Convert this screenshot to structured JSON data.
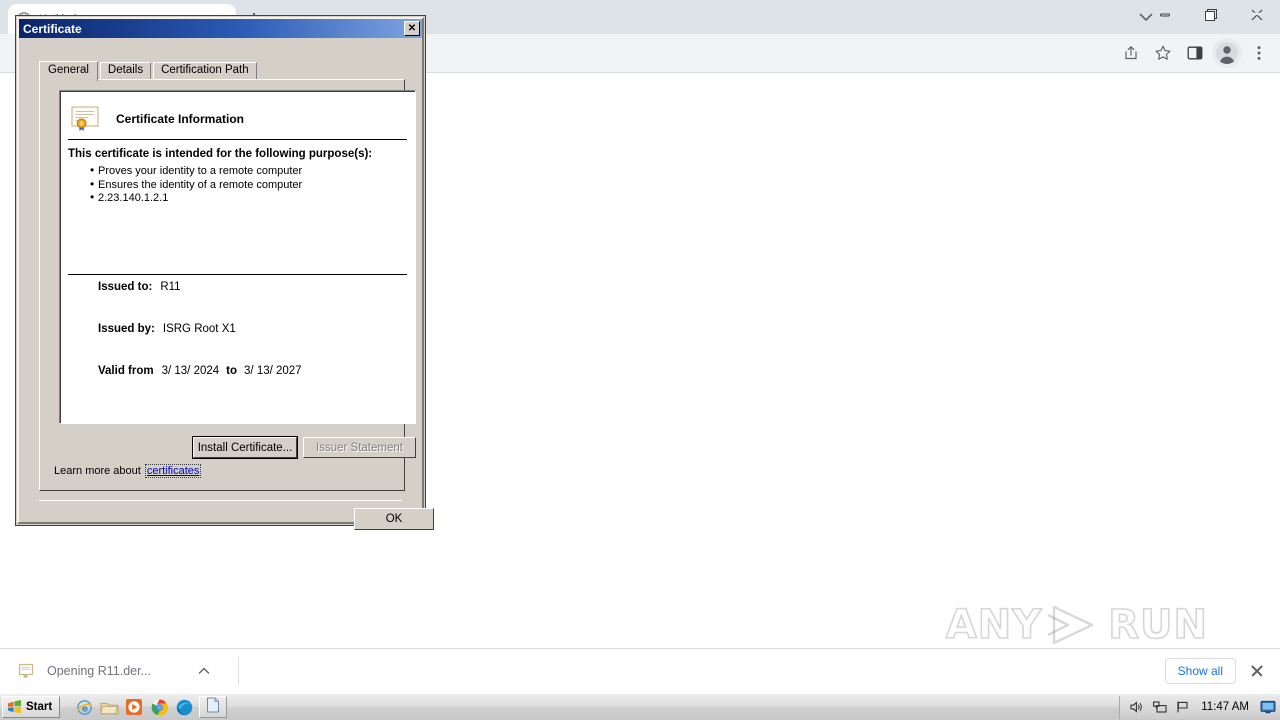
{
  "browser": {
    "tab": {
      "title": "Untitled",
      "favicon_icon": "globe-icon",
      "close_icon": "close-icon"
    },
    "new_tab_icon": "plus-icon",
    "tab_list_icon": "chevron-down-icon",
    "window_controls": [
      {
        "name": "minimize-button",
        "icon": "minimize-icon"
      },
      {
        "name": "maximize-button",
        "icon": "maximize-icon"
      },
      {
        "name": "close-button",
        "icon": "close-icon"
      }
    ],
    "toolbar_icons": [
      {
        "name": "share-button",
        "icon": "share-icon"
      },
      {
        "name": "bookmark-button",
        "icon": "star-icon"
      },
      {
        "name": "side-panel-button",
        "icon": "side-panel-icon"
      },
      {
        "name": "profile-button",
        "icon": "avatar-icon"
      },
      {
        "name": "chrome-menu-button",
        "icon": "three-dots-icon"
      }
    ]
  },
  "downloads": {
    "item_label": "Opening R11.der...",
    "item_icon": "file-download-icon",
    "expand_icon": "chevron-up-icon",
    "show_all_label": "Show all",
    "close_icon": "close-icon"
  },
  "watermark": {
    "text_left": "ANY",
    "text_right": "RUN",
    "logo_icon": "play-triangle-icon"
  },
  "taskbar": {
    "start_label": "Start",
    "start_icon": "windows-flag-icon",
    "quick_launch": [
      {
        "name": "taskbar-internet-explorer",
        "icon": "internet-explorer-icon"
      },
      {
        "name": "taskbar-file-explorer",
        "icon": "folder-icon"
      },
      {
        "name": "taskbar-media-player",
        "icon": "media-player-icon"
      },
      {
        "name": "taskbar-google-chrome",
        "icon": "chrome-icon"
      },
      {
        "name": "taskbar-microsoft-edge",
        "icon": "edge-icon"
      }
    ],
    "active_task_icon": "document-icon",
    "tray": [
      {
        "name": "tray-volume",
        "icon": "speaker-icon"
      },
      {
        "name": "tray-network",
        "icon": "network-icon"
      },
      {
        "name": "tray-notification",
        "icon": "flag-icon"
      }
    ],
    "clock": "11:47 AM",
    "show_desktop_icon": "monitor-icon"
  },
  "dialog": {
    "title": "Certificate",
    "close_glyph": "✕",
    "close_icon": "close-icon",
    "tabs": [
      {
        "label": "General",
        "active": true
      },
      {
        "label": "Details",
        "active": false
      },
      {
        "label": "Certification Path",
        "active": false
      }
    ],
    "header": {
      "icon": "certificate-seal-icon",
      "title": "Certificate Information"
    },
    "purpose_title": "This certificate is intended for the following purpose(s):",
    "purposes": [
      "Proves your identity to a remote computer",
      "Ensures the identity of a remote computer",
      "2.23.140.1.2.1"
    ],
    "fields": {
      "issued_to_label": "Issued to:",
      "issued_to_value": "R11",
      "issued_by_label": "Issued by:",
      "issued_by_value": "ISRG Root X1",
      "valid_from_label": "Valid from",
      "valid_from_value": "3/ 13/ 2024",
      "valid_to_joiner": "to",
      "valid_to_value": "3/ 13/ 2027"
    },
    "buttons": {
      "install": "Install Certificate...",
      "issuer_statement": "Issuer Statement",
      "ok": "OK"
    },
    "learn_more_prefix": "Learn more about",
    "learn_more_link": "certificates"
  }
}
